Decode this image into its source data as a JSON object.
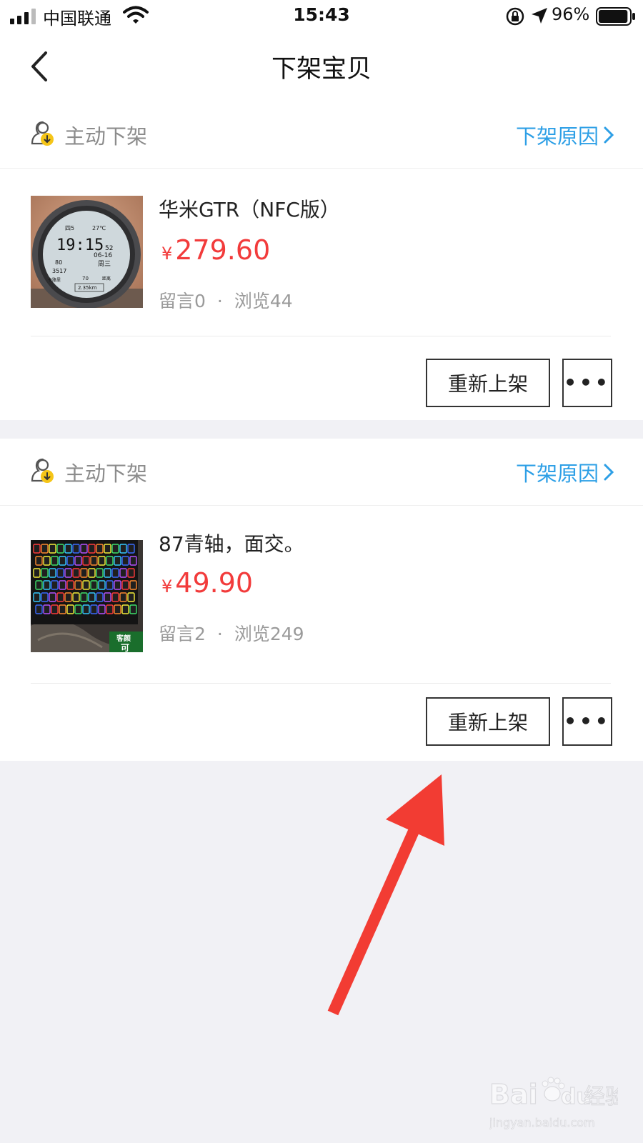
{
  "status_bar": {
    "carrier": "中国联通",
    "time": "15:43",
    "battery": "96%",
    "battery_level": 0.96
  },
  "nav": {
    "title": "下架宝贝"
  },
  "items": [
    {
      "status": "主动下架",
      "reason_link": "下架原因",
      "title": "华米GTR（NFC版）",
      "currency": "¥",
      "price": "279.60",
      "comments": "留言0",
      "separator": "·",
      "views": "浏览44",
      "relist_label": "重新上架",
      "more_label": "•••",
      "thumb_text": {
        "top_left": "四5",
        "top_right": "27℃",
        "time": "19:15",
        "seconds": "52",
        "date": "06-16",
        "weekday": "周三",
        "heart": "80",
        "steps": "3517",
        "label_cal": "卡路里",
        "value_70": "70",
        "label_dist": "距离",
        "distance": "2.35km"
      }
    },
    {
      "status": "主动下架",
      "reason_link": "下架原因",
      "title": "87青轴，面交。",
      "currency": "¥",
      "price": "49.90",
      "comments": "留言2",
      "separator": "·",
      "views": "浏览249",
      "relist_label": "重新上架",
      "more_label": "•••",
      "thumb_text": {
        "badge_line1": "客颜",
        "badge_line2": "可"
      }
    }
  ],
  "watermark": {
    "brand": "Bai",
    "brand_tail": "du",
    "cn": "经验",
    "url": "jingyan.baidu.com"
  },
  "colors": {
    "accent_blue": "#2d9fe6",
    "price_red": "#f23b3b",
    "arrow_red": "#f23c33",
    "page_bg": "#f1f1f5"
  }
}
